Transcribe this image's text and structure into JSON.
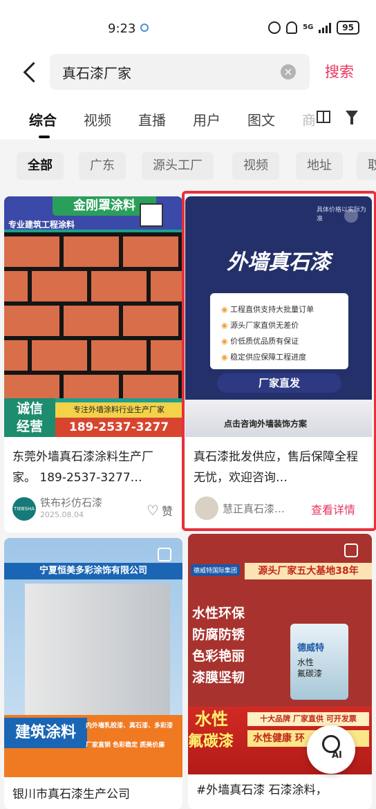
{
  "status_bar": {
    "time": "9:23",
    "network": "5G",
    "battery": "95"
  },
  "search": {
    "query": "真石漆厂家",
    "button_label": "搜索"
  },
  "tabs": [
    "综合",
    "视频",
    "直播",
    "用户",
    "图文",
    "商"
  ],
  "chips": [
    "全部",
    "广东",
    "源头工厂",
    "视频",
    "地址",
    "取"
  ],
  "cards": [
    {
      "banner": "金刚罩涂料",
      "image_subtitle": "专业建筑工程涂料",
      "badge_line1": "诚信",
      "badge_line2": "经营",
      "slogan": "专注外墙涂料行业生产厂家",
      "phone": "189-2537-3277",
      "title": "东莞外墙真石漆涂料生产厂家。  189-2537-3277…",
      "author": "铁布衫仿石漆",
      "avatar_text": "TIEBSHA",
      "date": "2025.08.04",
      "like_label": "赞"
    },
    {
      "corner_note": "具体价格以实际为准",
      "headline": "外墙真石漆",
      "bullets": [
        "工程直供支持大批量订单",
        "源头厂家直供无差价",
        "价低质优品质有保证",
        "稳定供应保障工程进度"
      ],
      "cta": "厂家直发",
      "footer_text": "点击咨询外墙装饰方案",
      "title": "真石漆批发供应，售后保障全程无忧，欢迎咨询…",
      "author": "慧正真石漆…",
      "detail_link": "查看详情"
    },
    {
      "banner": "宁夏恒美多彩涂饰有限公司",
      "big_text": "建筑涂料",
      "tag1": "内外墙乳胶漆、真石漆、多彩漆",
      "tag2": "厂家直销 色彩稳定 质美价廉",
      "title": "银川市真石漆生产公司"
    },
    {
      "brand": "德威特国际集团",
      "banner": "源头厂家五大基地38年",
      "features": [
        "水性环保",
        "防腐防锈",
        "色彩艳丽",
        "漆膜坚韧"
      ],
      "can_brand": "德威特",
      "can_label": "水性\n氟碳漆",
      "big_label_1": "水性",
      "big_label_2": "氟碳漆",
      "ribbon": "十大品牌 厂家直供 可开发票",
      "ribbon2": "水性健康 环",
      "title": "#外墙真石漆  石漆涂料，"
    }
  ],
  "ai_button": "AI"
}
